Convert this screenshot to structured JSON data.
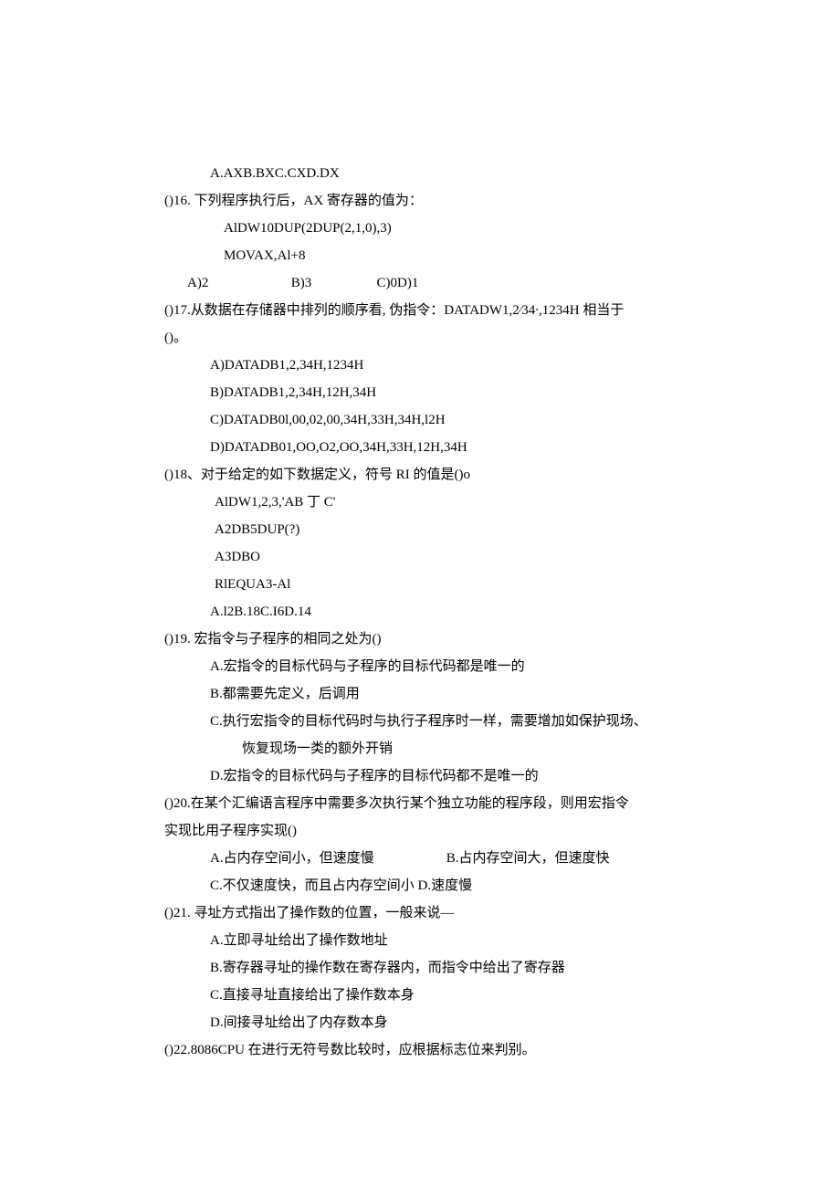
{
  "lines": {
    "l1": "A.AXB.BXC.CXD.DX",
    "l2": "()16. 下列程序执行后，AX 寄存器的值为：",
    "l3": "AlDW10DUP(2DUP(2,1,0),3)",
    "l4": "MOVAX,Al+8",
    "l5a": "A)2",
    "l5b": "B)3",
    "l5c": "C)0D)1",
    "l6": "()17.从数据在存储器中排列的顺序看, 伪指令：DATADW1,2⁄34∙,1234H 相当于",
    "l7": "()。",
    "l8": "A)DATADB1,2,34H,1234H",
    "l9": "B)DATADB1,2,34H,12H,34H",
    "l10": "C)DATADB0l,00,02,00,34H,33H,34H,l2H",
    "l11": "D)DATADB01,OO,O2,OO,34H,33H,12H,34H",
    "l12": "()18、对于给定的如下数据定义，符号 RI 的值是()o",
    "l13": "AlDW1,2,3,'AB 丁 C'",
    "l14": "A2DB5DUP(?)",
    "l15": "A3DBO",
    "l16": "RlEQUA3-Al",
    "l17": "A.l2B.18C.I6D.14",
    "l18": "()19. 宏指令与子程序的相同之处为()",
    "l19": "A.宏指令的目标代码与子程序的目标代码都是唯一的",
    "l20": "B.都需要先定义，后调用",
    "l21": "C.执行宏指令的目标代码时与执行子程序时一样，需要增加如保护现场、",
    "l22": "恢复现场一类的额外开销",
    "l23": "D.宏指令的目标代码与子程序的目标代码都不是唯一的",
    "l24": "()20.在某个汇编语言程序中需要多次执行某个独立功能的程序段，则用宏指令",
    "l25": "实现比用子程序实现()",
    "l26a": "A.占内存空间小，但速度慢",
    "l26b": "B.占内存空间大，但速度快",
    "l27": "C.不仅速度快，而且占内存空间小 D.速度慢",
    "l28": "()21. 寻址方式指出了操作数的位置，一般来说—",
    "l29": "A.立即寻址给出了操作数地址",
    "l30": "B.寄存器寻址的操作数在寄存器内，而指令中给出了寄存器",
    "l31": "C.直接寻址直接给出了操作数本身",
    "l32": "D.间接寻址给出了内存数本身",
    "l33": "()22.8086CPU 在进行无符号数比较时，应根据标志位来判别。"
  }
}
